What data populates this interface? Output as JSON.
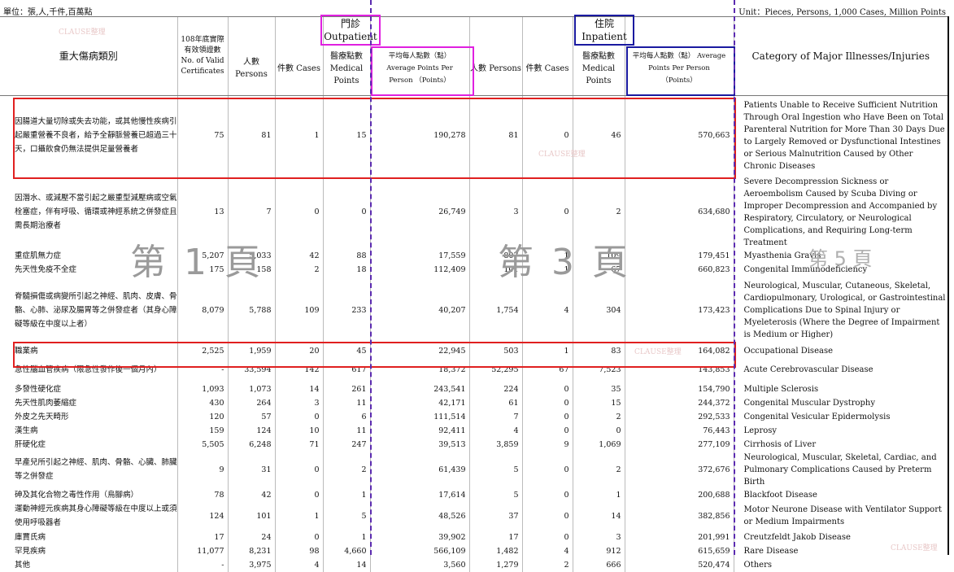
{
  "unit_left": "單位：張,人,千件,百萬點",
  "unit_right": "Unit：Pieces, Persons, 1,000 Cases, Million Points",
  "headers": {
    "category_zh": "重大傷病類別",
    "certs": "108年底實際有效領證數 No. of Valid Certificates",
    "outpatient": "門診 Outpatient",
    "inpatient": "住院 Inpatient",
    "persons": "人數 Persons",
    "cases": "件數 Cases",
    "points": "醫療點數 Medical Points",
    "avg": "平均每人點數（點） Average Points Per Person （Points）",
    "category_en": "Category of Major Illnesses/Injuries"
  },
  "rows": [
    {
      "zh": "因腸道大量切除或失去功能，或其他慢性疾病引起嚴重營養不良者，給予全靜脈營養已超過三十天，口攝飲食仍無法提供足量營養者",
      "c": "75",
      "op": "81",
      "oc": "1",
      "om": "15",
      "oa": "190,278",
      "ip": "81",
      "ic": "0",
      "im": "46",
      "ia": "570,663",
      "en": "Patients Unable to Receive Sufficient Nutrition Through Oral Ingestion who Have Been on Total Parenteral Nutrition for More Than 30 Days Due to Largely Removed or Dysfunctional Intestines or Serious Malnutrition Caused by Other Chronic Diseases"
    },
    {
      "zh": "因潛水、或減壓不當引起之嚴重型減壓病或空氣栓塞症，伴有呼吸、循環或神經系統之併發症且需長期治療者",
      "c": "13",
      "op": "7",
      "oc": "0",
      "om": "0",
      "oa": "26,749",
      "ip": "3",
      "ic": "0",
      "im": "2",
      "ia": "634,680",
      "en": "Severe Decompression Sickness or Aeroembolism Caused by Scuba Diving or Improper Decompression and Accompanied by Respiratory, Circulatory, or Neurological Complications, and Requiring Long-term Treatment"
    },
    {
      "zh": "重症肌無力症",
      "c": "5,207",
      "op": "5,033",
      "oc": "42",
      "om": "88",
      "oa": "17,559",
      "ip": "807",
      "ic": "1",
      "im": "109",
      "ia": "179,451",
      "en": "Myasthenia Gravis"
    },
    {
      "zh": "先天性免疫不全症",
      "c": "175",
      "op": "158",
      "oc": "2",
      "om": "18",
      "oa": "112,409",
      "ip": "101",
      "ic": "1",
      "im": "67",
      "ia": "660,823",
      "en": "Congenital Immunodeficiency"
    },
    {
      "zh": "脊髓損傷或病變所引起之神經、肌肉、皮膚、骨骼、心肺、泌尿及腸胃等之併發症者（其身心障礙等級在中度以上者）",
      "c": "8,079",
      "op": "5,788",
      "oc": "109",
      "om": "233",
      "oa": "40,207",
      "ip": "1,754",
      "ic": "4",
      "im": "304",
      "ia": "173,423",
      "en": "Neurological, Muscular, Cutaneous, Skeletal, Cardiopulmonary, Urological, or Gastrointestinal Complications Due to Spinal Injury or Myeleterosis (Where the Degree of Impairment is Medium or Higher)"
    },
    {
      "zh": "職業病",
      "c": "2,525",
      "op": "1,959",
      "oc": "20",
      "om": "45",
      "oa": "22,945",
      "ip": "503",
      "ic": "1",
      "im": "83",
      "ia": "164,082",
      "en": "Occupational Disease"
    },
    {
      "zh": "急性腦血管疾病（限急性發作後一個月內）",
      "c": "-",
      "op": "33,594",
      "oc": "142",
      "om": "617",
      "oa": "18,372",
      "ip": "52,295",
      "ic": "67",
      "im": "7,523",
      "ia": "143,853",
      "en": "Acute Cerebrovascular Disease"
    },
    {
      "zh": "多發性硬化症",
      "c": "1,093",
      "op": "1,073",
      "oc": "14",
      "om": "261",
      "oa": "243,541",
      "ip": "224",
      "ic": "0",
      "im": "35",
      "ia": "154,790",
      "en": "Multiple Sclerosis"
    },
    {
      "zh": "先天性肌肉萎縮症",
      "c": "430",
      "op": "264",
      "oc": "3",
      "om": "11",
      "oa": "42,171",
      "ip": "61",
      "ic": "0",
      "im": "15",
      "ia": "244,372",
      "en": "Congenital Muscular Dystrophy"
    },
    {
      "zh": "外皮之先天畸形",
      "c": "120",
      "op": "57",
      "oc": "0",
      "om": "6",
      "oa": "111,514",
      "ip": "7",
      "ic": "0",
      "im": "2",
      "ia": "292,533",
      "en": "Congenital Vesicular Epidermolysis"
    },
    {
      "zh": "漢生病",
      "c": "159",
      "op": "124",
      "oc": "10",
      "om": "11",
      "oa": "92,411",
      "ip": "4",
      "ic": "0",
      "im": "0",
      "ia": "76,443",
      "en": "Leprosy"
    },
    {
      "zh": "肝硬化症",
      "c": "5,505",
      "op": "6,248",
      "oc": "71",
      "om": "247",
      "oa": "39,513",
      "ip": "3,859",
      "ic": "9",
      "im": "1,069",
      "ia": "277,109",
      "en": "Cirrhosis of Liver"
    },
    {
      "zh": "早產兒所引起之神經、肌肉、骨骼、心臟、肺臟等之併發症",
      "c": "9",
      "op": "31",
      "oc": "0",
      "om": "2",
      "oa": "61,439",
      "ip": "5",
      "ic": "0",
      "im": "2",
      "ia": "372,676",
      "en": "Neurological, Muscular, Skeletal, Cardiac, and Pulmonary Complications Caused by Preterm Birth"
    },
    {
      "zh": "砷及其化合物之毒性作用（烏腳病）",
      "c": "78",
      "op": "42",
      "oc": "0",
      "om": "1",
      "oa": "17,614",
      "ip": "5",
      "ic": "0",
      "im": "1",
      "ia": "200,688",
      "en": "Blackfoot Disease"
    },
    {
      "zh": "運動神經元疾病其身心障礙等級在中度以上或須使用呼吸器者",
      "c": "124",
      "op": "101",
      "oc": "1",
      "om": "5",
      "oa": "48,526",
      "ip": "37",
      "ic": "0",
      "im": "14",
      "ia": "382,856",
      "en": "Motor Neurone Disease with Ventilator Support or Medium Impairments"
    },
    {
      "zh": "庫賈氏病",
      "c": "17",
      "op": "24",
      "oc": "0",
      "om": "1",
      "oa": "39,902",
      "ip": "17",
      "ic": "0",
      "im": "3",
      "ia": "201,991",
      "en": "Creutzfeldt Jakob Disease"
    },
    {
      "zh": "罕見疾病",
      "c": "11,077",
      "op": "8,231",
      "oc": "98",
      "om": "4,660",
      "oa": "566,109",
      "ip": "1,482",
      "ic": "4",
      "im": "912",
      "ia": "615,659",
      "en": "Rare Disease"
    },
    {
      "zh": "其他",
      "c": "-",
      "op": "3,975",
      "oc": "4",
      "om": "14",
      "oa": "3,560",
      "ip": "1,279",
      "ic": "2",
      "im": "666",
      "ia": "520,474",
      "en": "Others"
    }
  ],
  "watermarks": {
    "page1": "第 1 頁",
    "page3": "第 3 頁",
    "page5": "第 5 頁",
    "clause": "CLAUSE整理"
  }
}
